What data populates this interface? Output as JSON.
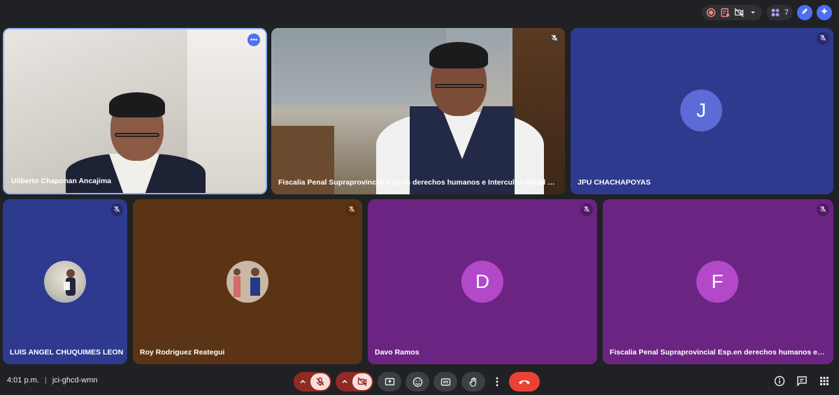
{
  "top_bar": {
    "participant_count": "7"
  },
  "tiles": [
    {
      "name": "Uliberto Chaponan Ancajima",
      "type": "video"
    },
    {
      "name": "Fiscalia Penal Supraprovincial Esp.en derechos humanos e Interculturalidad del Dist...",
      "type": "video"
    },
    {
      "name": "JPU CHACHAPOYAS",
      "type": "avatar",
      "initial": "J",
      "avatar_color": "#5c6bd6",
      "bg_color": "#2e3a8e"
    },
    {
      "name": "LUIS ANGEL CHUQUIMES LEON",
      "type": "photo-avatar",
      "bg_color": "#2e3a8e"
    },
    {
      "name": "Roy Rodriguez Reategui",
      "type": "photo-avatar",
      "bg_color": "#5a3414"
    },
    {
      "name": "Davo Ramos",
      "type": "avatar",
      "initial": "D",
      "avatar_color": "#b349c9",
      "bg_color": "#6c2483"
    },
    {
      "name": "Fiscalia Penal Supraprovincial Esp.en derechos humanos e Inter...",
      "type": "avatar",
      "initial": "F",
      "avatar_color": "#b349c9",
      "bg_color": "#6c2483"
    }
  ],
  "bottom_bar": {
    "time": "4:01 p.m.",
    "separator": "|",
    "meeting_code": "jci-ghcd-wmn"
  },
  "colors": {
    "background": "#202124",
    "end_call": "#ea4335",
    "mic_off_bg": "#8f2a24",
    "active_speaker_border": "#8ab4f8"
  }
}
